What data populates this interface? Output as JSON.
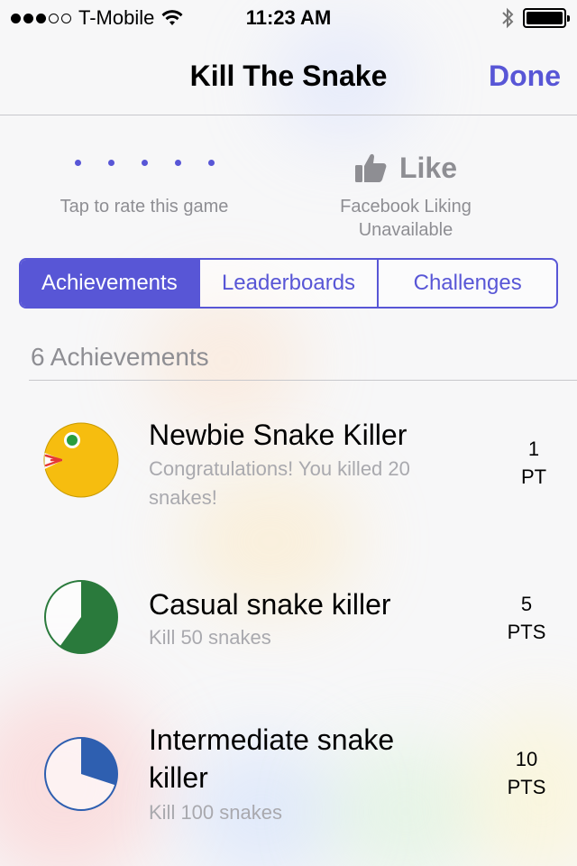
{
  "status_bar": {
    "carrier": "T-Mobile",
    "time": "11:23 AM",
    "signal_dots_filled": 3,
    "signal_dots_total": 5
  },
  "nav": {
    "title": "Kill The Snake",
    "done_label": "Done"
  },
  "rating": {
    "label": "Tap to rate this game"
  },
  "like": {
    "label": "Like",
    "subtitle_line1": "Facebook Liking",
    "subtitle_line2": "Unavailable"
  },
  "tabs": [
    {
      "label": "Achievements",
      "active": true
    },
    {
      "label": "Leaderboards",
      "active": false
    },
    {
      "label": "Challenges",
      "active": false
    }
  ],
  "section": {
    "header": "6 Achievements"
  },
  "achievements": [
    {
      "title": "Newbie Snake Killer",
      "description_line1": "Congratulations! You killed 20",
      "description_line2": "snakes!",
      "points_value": "1",
      "points_unit": "PT",
      "icon": "snake-head-icon"
    },
    {
      "title": "Casual snake killer",
      "description_line1": "Kill 50 snakes",
      "points_value": "5",
      "points_unit": "PTS",
      "icon": "progress-pie-icon",
      "progress": 0.6,
      "color": "#2a7a3c"
    },
    {
      "title_line1": "Intermediate snake",
      "title_line2": "killer",
      "description_line1": "Kill 100 snakes",
      "points_value": "10",
      "points_unit": "PTS",
      "icon": "progress-pie-icon",
      "progress": 0.3,
      "color": "#2e5fb0"
    }
  ],
  "colors": {
    "accent": "#5856d6",
    "secondary_text": "#8e8e93"
  }
}
